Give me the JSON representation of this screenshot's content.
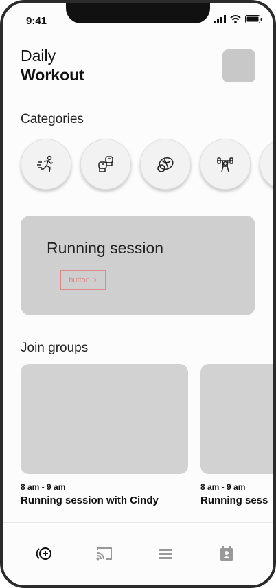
{
  "status_bar": {
    "time": "9:41"
  },
  "header": {
    "title_line1": "Daily",
    "title_line2": "Workout"
  },
  "categories": {
    "title": "Categories",
    "items": [
      {
        "icon": "running-icon"
      },
      {
        "icon": "boxing-icon"
      },
      {
        "icon": "ball-icon"
      },
      {
        "icon": "weightlifting-icon"
      },
      {
        "icon": "more-category-icon"
      }
    ]
  },
  "hero": {
    "title": "Running session",
    "button_label": "button"
  },
  "groups": {
    "title": "Join groups",
    "cards": [
      {
        "time": "8 am - 9 am",
        "title": "Running session with Cindy"
      },
      {
        "time": "8 am - 9 am",
        "title": "Running sess"
      }
    ]
  },
  "tab_bar": {
    "items": [
      {
        "icon": "add-circle-icon"
      },
      {
        "icon": "cast-icon"
      },
      {
        "icon": "list-icon"
      },
      {
        "icon": "contacts-icon"
      }
    ]
  },
  "colors": {
    "accent_outline": "#d98b8b",
    "placeholder": "#cfcfcf"
  }
}
